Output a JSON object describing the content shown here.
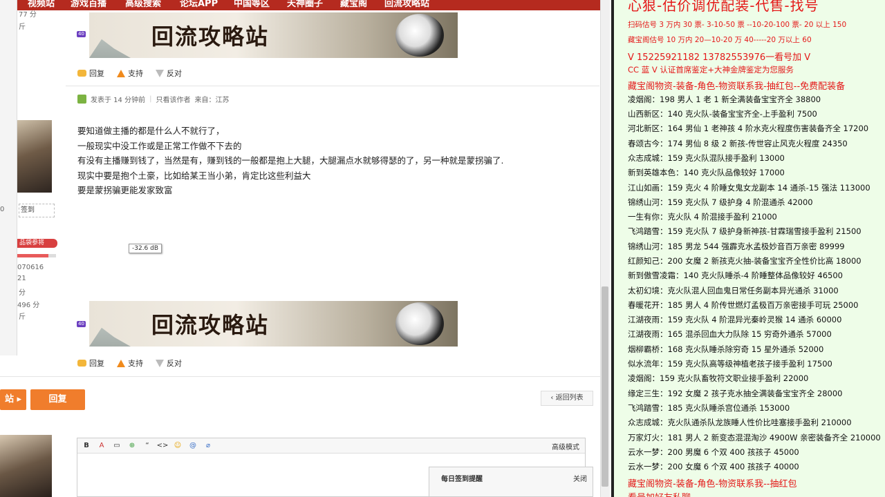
{
  "topnav": {
    "items": [
      "视频站",
      "游戏百播",
      "高级搜索",
      "论坛APP",
      "中国等区",
      "天神圈子",
      "藏宝阁",
      "回流攻略站"
    ]
  },
  "side": {
    "top_texts": [
      "77 分",
      "斤"
    ],
    "sign": "签到",
    "tag": "品袋参将",
    "stats": [
      "070616",
      "21",
      "分",
      "496 分",
      "斤"
    ],
    "left_mark": "0"
  },
  "banner": {
    "text": "回流攻略站",
    "badge": "40"
  },
  "actions": {
    "reply": "回复",
    "support": "支持",
    "oppose": "反对"
  },
  "post": {
    "meta_time": "发表于 14 分钟前",
    "meta_only": "只看该作者",
    "meta_from": "来自：江苏",
    "lines": [
      "要知道做主播的都是什么人不就行了，",
      "一般现实中没工作或是正常工作做不下去的",
      "有没有主播赚到钱了，当然是有，赚到钱的一般都是抱上大腿，大腿漏点水就够得瑟的了，另一种就是蒙拐骗了.",
      "现实中要是抱个土豪，比如给某王当小弟，肯定比这些利益大",
      "要是蒙拐骗更能发家致富"
    ]
  },
  "db_tooltip": "-32.6 dB",
  "buttons": {
    "prev": "站",
    "reply": "回复",
    "back_list": "返回列表"
  },
  "editor": {
    "tools": [
      "B",
      "A",
      "▭",
      "⊕",
      "“",
      "<>",
      "☺",
      "@",
      "⌀"
    ],
    "advanced": "高级模式"
  },
  "signin_popup": {
    "title": "每日签到提醒",
    "close": "关闭"
  },
  "right": {
    "title": "心狠-估价调优配装-代售-找号",
    "lines": [
      {
        "text": "扫码估号 3 万内 30 票- 3-10-50 票 --10-20-100 票- 20 以上 150",
        "style": "red small"
      },
      {
        "text": "藏宝阁估号 10 万内 20—10-20 万 40-----20 万以上 60",
        "style": "red small"
      },
      {
        "text": "V 15225921182    13782553976一看号加 V",
        "style": "red mid"
      },
      {
        "text": "CC 蓝 V 认证首席鉴定+大神金牌鉴定为您服务",
        "style": "red"
      },
      {
        "text": "藏宝阁物资-装备-角色-物资联系我-抽红包--免费配装备",
        "style": "red mid"
      },
      {
        "text": "凌烟阁：198 男人 1 老 1 新全满装备宝宝齐全 38800",
        "style": ""
      },
      {
        "text": "山西新区：140 克火队-装备宝宝齐全-上手盈利 7500",
        "style": ""
      },
      {
        "text": "河北新区：164 男仙 1 老神孩 4 阶水克火程度伤害装备齐全 17200",
        "style": ""
      },
      {
        "text": "春颂古今：174 男仙 8 级 2 新孩-传世容止风克火程度 24350",
        "style": ""
      },
      {
        "text": "众志成城：159 克火队混队接手盈利 13000",
        "style": ""
      },
      {
        "text": "新到英雄本色：140 克火队品像较好 17000",
        "style": ""
      },
      {
        "text": "江山如画：159 克火 4 阶睡女鬼女龙副本 14 通杀-15 强法 113000",
        "style": ""
      },
      {
        "text": "锦绣山河：159 克火队 7 级护身 4 阶混通杀 42000",
        "style": ""
      },
      {
        "text": "一生有你：克火队 4 阶混接手盈利 21000",
        "style": ""
      },
      {
        "text": "飞鸿踏雪：159 克火队 7 级护身新神孩-甘霖瑞雪接手盈利 21500",
        "style": ""
      },
      {
        "text": "锦绣山河：185 男龙 544 强霹克水孟极妙音百万亲密 89999",
        "style": ""
      },
      {
        "text": "红颜知己：200 女魔 2 新孩克火抽-装备宝宝齐全性价比高 18000",
        "style": ""
      },
      {
        "text": "新到傲雪凌霜：140 克火队睡杀-4 阶睡整体品像较好 46500",
        "style": ""
      },
      {
        "text": "太初幻境：克火队混人回血鬼日常任务副本异光通杀 31000",
        "style": ""
      },
      {
        "text": "春暖花开：185 男人 4 阶传世燃灯孟极百万亲密接手可玩 25000",
        "style": ""
      },
      {
        "text": "江湖夜雨：159 克火队 4 阶混异光秦岭灵猴 14 通杀 60000",
        "style": ""
      },
      {
        "text": "江湖夜雨：165 混杀回血大力队除 15 穷奇外通杀 57000",
        "style": ""
      },
      {
        "text": "烟柳霸桥：168 克火队睡杀除穷奇 15 星外通杀 52000",
        "style": ""
      },
      {
        "text": "似水流年：159 克火队高等级神植老孩子接手盈利 17500",
        "style": ""
      },
      {
        "text": "凌烟阁：159 克火队畜牧符文职业接手盈利 22000",
        "style": ""
      },
      {
        "text": "缘定三生：192 女魔 2 孩子克水抽全满装备宝宝齐全 28000",
        "style": ""
      },
      {
        "text": "飞鸿踏雪：185 克火队睡杀宫位通杀 153000",
        "style": ""
      },
      {
        "text": "众志成城：克火队通杀队龙族睡人性价比哇塞接手盈利 210000",
        "style": ""
      },
      {
        "text": "万家灯火：181 男人 2 新变态混混淘沙 4900W 亲密装备齐全 210000",
        "style": ""
      },
      {
        "text": "云水一梦：200 男魔 6 个双 400 孩孩子 45000",
        "style": ""
      },
      {
        "text": "云水一梦：200 女魔 6 个双 400 孩孩子 40000",
        "style": ""
      },
      {
        "text": "藏宝阁物资-装备-角色-物资联系我--抽红包",
        "style": "red mid"
      },
      {
        "text": "看号加好友私聊",
        "style": "red mid"
      }
    ]
  },
  "colors": {
    "nav_red": "#b52a1f",
    "accent_orange": "#f07d2c",
    "right_bg": "#eefde8",
    "right_red": "#e41818"
  }
}
